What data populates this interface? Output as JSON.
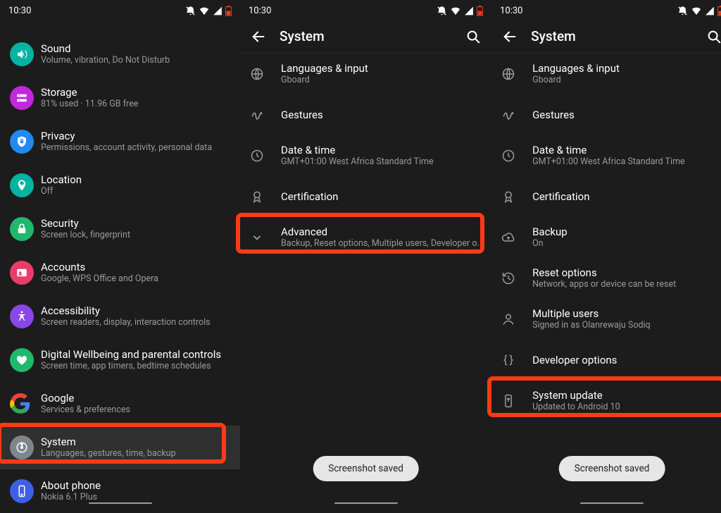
{
  "status_time": "10:30",
  "snackbar": "Screenshot saved",
  "panel1": {
    "items": [
      {
        "title": "Sound",
        "sub": "Volume, vibration, Do Not Disturb",
        "disc": "#02b3a1"
      },
      {
        "title": "Storage",
        "sub": "81% used · 11.96 GB free",
        "disc": "#c028de"
      },
      {
        "title": "Privacy",
        "sub": "Permissions, account activity, personal data",
        "disc": "#2189ef"
      },
      {
        "title": "Location",
        "sub": "Off",
        "disc": "#02b3a1"
      },
      {
        "title": "Security",
        "sub": "Screen lock, fingerprint",
        "disc": "#1fb96b"
      },
      {
        "title": "Accounts",
        "sub": "Google, WPS Office and Opera",
        "disc": "#e83d6a"
      },
      {
        "title": "Accessibility",
        "sub": "Screen readers, display, interaction controls",
        "disc": "#8a46e8"
      },
      {
        "title": "Digital Wellbeing and parental controls",
        "sub": "Screen time, app timers, bedtime schedules",
        "disc": "#1fb96b"
      },
      {
        "title": "Google",
        "sub": "Services & preferences",
        "disc": "#ffffff"
      },
      {
        "title": "System",
        "sub": "Languages, gestures, time, backup",
        "disc": "#7d868b",
        "hl": true
      },
      {
        "title": "About phone",
        "sub": "Nokia 6.1 Plus",
        "disc": "#3e5fe4"
      }
    ]
  },
  "panel2": {
    "title": "System",
    "items": [
      {
        "title": "Languages & input",
        "sub": "Gboard",
        "icon": "globe"
      },
      {
        "title": "Gestures",
        "icon": "gesture"
      },
      {
        "title": "Date & time",
        "sub": "GMT+01:00 West Africa Standard Time",
        "icon": "clock"
      },
      {
        "title": "Certification",
        "icon": "ribbon"
      },
      {
        "title": "Advanced",
        "sub": "Backup, Reset options, Multiple users, Developer o..",
        "icon": "chevron",
        "hl": true
      }
    ]
  },
  "panel3": {
    "title": "System",
    "items": [
      {
        "title": "Languages & input",
        "sub": "Gboard",
        "icon": "globe"
      },
      {
        "title": "Gestures",
        "icon": "gesture"
      },
      {
        "title": "Date & time",
        "sub": "GMT+01:00 West Africa Standard Time",
        "icon": "clock"
      },
      {
        "title": "Certification",
        "icon": "ribbon"
      },
      {
        "title": "Backup",
        "sub": "On",
        "icon": "cloud"
      },
      {
        "title": "Reset options",
        "sub": "Network, apps or device can be reset",
        "icon": "restore"
      },
      {
        "title": "Multiple users",
        "sub": "Signed in as Olanrewaju Sodiq",
        "icon": "person"
      },
      {
        "title": "Developer options",
        "icon": "braces"
      },
      {
        "title": "System update",
        "sub": "Updated to Android 10",
        "icon": "update",
        "hl": true
      }
    ]
  }
}
